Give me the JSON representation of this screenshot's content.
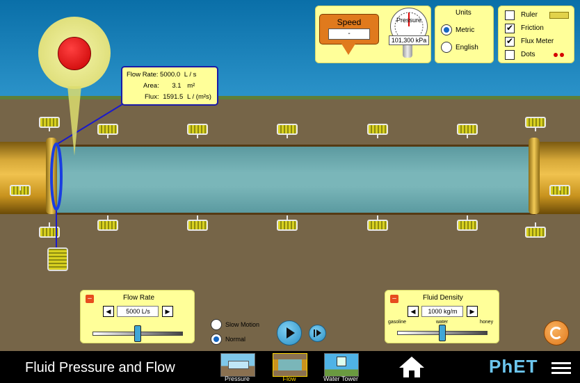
{
  "app": {
    "title": "Fluid Pressure and Flow",
    "brand": "PhET"
  },
  "nav": {
    "items": [
      {
        "label": "Pressure"
      },
      {
        "label": "Flow",
        "active": true
      },
      {
        "label": "Water Tower"
      }
    ],
    "home_icon": "home-icon",
    "menu_icon": "hamburger-icon"
  },
  "speed_panel": {
    "title": "Speed",
    "value": "-"
  },
  "pressure_gauge": {
    "title": "Pressure",
    "value": "101,300 kPa"
  },
  "units_panel": {
    "title": "Units",
    "options": [
      {
        "label": "Metric",
        "selected": true
      },
      {
        "label": "English",
        "selected": false
      }
    ]
  },
  "options_panel": {
    "items": [
      {
        "label": "Ruler",
        "checked": false
      },
      {
        "label": "Friction",
        "checked": true
      },
      {
        "label": "Flux Meter",
        "checked": true
      },
      {
        "label": "Dots",
        "checked": false
      }
    ]
  },
  "flux_meter": {
    "flow_rate_label": "Flow Rate:",
    "flow_rate_value": "5000.0",
    "flow_rate_unit": "L / s",
    "area_label": "Area:",
    "area_value": "3.1",
    "area_unit": "m²",
    "flux_label": "Flux:",
    "flux_value": "1591.5",
    "flux_unit": "L / (m²s)"
  },
  "flow_rate_panel": {
    "title": "Flow Rate",
    "value": "5000 L/s",
    "minus": "–",
    "fraction": 0.5
  },
  "fluid_density_panel": {
    "title": "Fluid Density",
    "value": "1000 kg/m",
    "minus": "–",
    "tick_labels": [
      "gasoline",
      "water",
      "honey"
    ],
    "fraction": 0.5
  },
  "playback": {
    "options": [
      {
        "label": "Slow Motion",
        "selected": false
      },
      {
        "label": "Normal",
        "selected": true
      }
    ]
  },
  "colors": {
    "panel": "#ffff99",
    "accent": "#e74c1e",
    "water": "#7ab6b9",
    "pipe": "#d6a838"
  }
}
